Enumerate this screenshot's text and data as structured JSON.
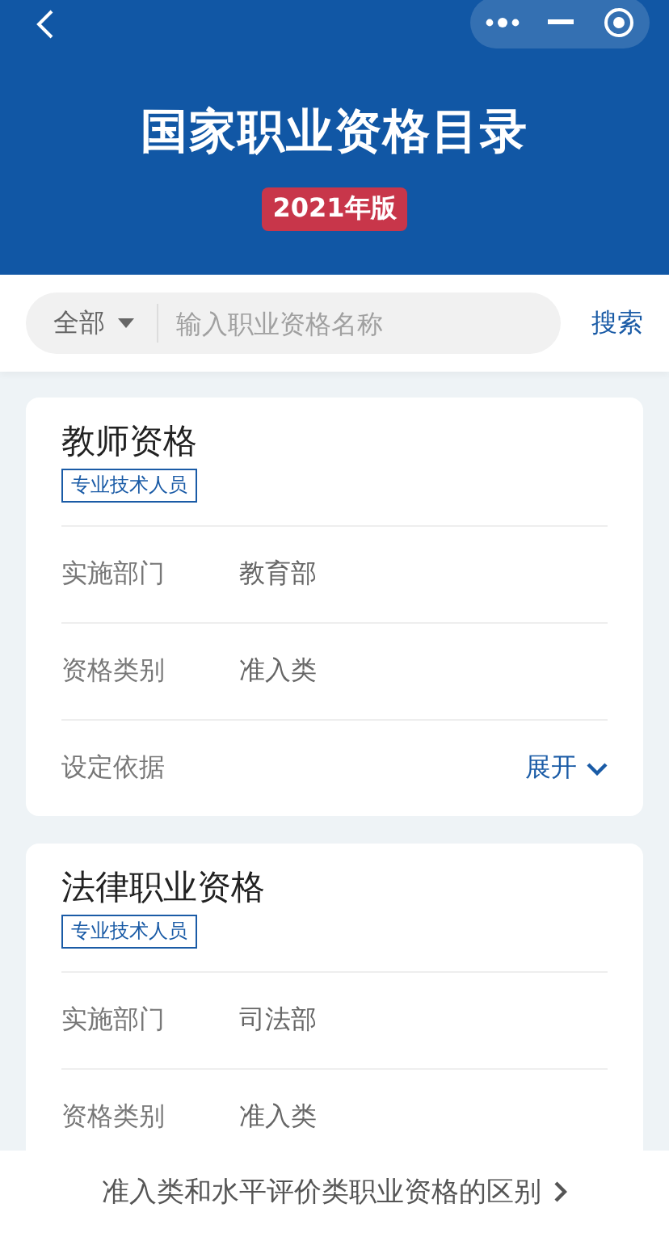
{
  "header": {
    "title": "国家职业资格目录",
    "badge": "2021年版"
  },
  "search": {
    "scope": "全部",
    "placeholder": "输入职业资格名称",
    "button": "搜索"
  },
  "cards": [
    {
      "title": "教师资格",
      "tag": "专业技术人员",
      "rows": [
        {
          "kind": "field",
          "label": "实施部门",
          "value": "教育部"
        },
        {
          "kind": "field",
          "label": "资格类别",
          "value": "准入类"
        },
        {
          "kind": "expand",
          "label": "设定依据",
          "value": "展开"
        }
      ]
    },
    {
      "title": "法律职业资格",
      "tag": "专业技术人员",
      "rows": [
        {
          "kind": "field",
          "label": "实施部门",
          "value": "司法部"
        },
        {
          "kind": "field",
          "label": "资格类别",
          "value": "准入类"
        }
      ]
    }
  ],
  "footer_link": "准入类和水平评价类职业资格的区别"
}
